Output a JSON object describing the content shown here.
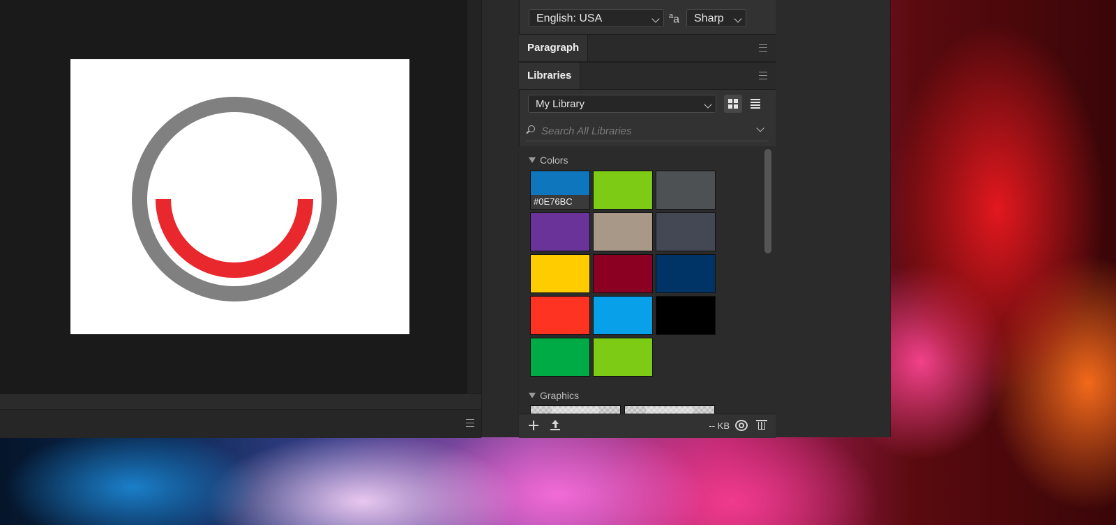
{
  "character": {
    "language": "English: USA",
    "aa_glyph": "a",
    "aa_glyph_small": "a",
    "antialias": "Sharp"
  },
  "tabs": {
    "paragraph": "Paragraph",
    "libraries": "Libraries"
  },
  "libraries": {
    "selected_library": "My Library",
    "search_placeholder": "Search All Libraries",
    "colors_heading": "Colors",
    "graphics_heading": "Graphics",
    "hovered_color_label": "#0E76BC",
    "colors": [
      "#0E76BC",
      "#7ECB16",
      "#4E5154",
      "#6A3399",
      "#A89888",
      "#434854",
      "#FFCC00",
      "#8B0022",
      "#003366",
      "#FF3322",
      "#08A0E8",
      "#000000",
      "#00AA44",
      "#7ECB16"
    ],
    "size_text": "-- KB"
  },
  "artwork": {
    "ring_color": "#808080",
    "fill_color": "#E8282C",
    "level_percent": 50
  }
}
